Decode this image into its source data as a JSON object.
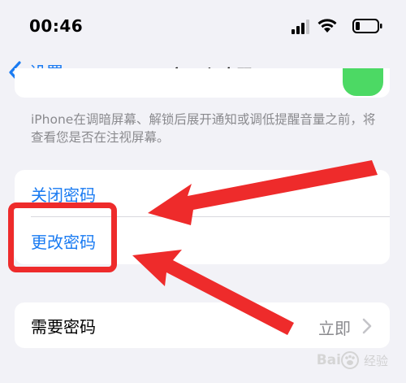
{
  "status_bar": {
    "time": "00:46"
  },
  "nav": {
    "back_label": "设置",
    "title": "面容ID与密码"
  },
  "footer_note": "iPhone在调暗屏幕、解锁后展开通知或调低提醒音量之前，将查看您是否在注视屏幕。",
  "group_1": {
    "items": [
      {
        "label": "关闭密码"
      },
      {
        "label": "更改密码"
      }
    ]
  },
  "group_2": {
    "row": {
      "label": "需要密码",
      "value": "立即"
    }
  },
  "watermark": {
    "text": "Bai",
    "sub": "经验"
  },
  "colors": {
    "link": "#1a7bf2",
    "annotation_red": "#ee2b2b",
    "toggle_green": "#4cd964",
    "background": "#f2f2f7"
  },
  "icons": [
    "chevron-left-icon",
    "signal-icon",
    "wifi-icon",
    "battery-icon",
    "chevron-right-icon",
    "baidu-paw-icon"
  ]
}
